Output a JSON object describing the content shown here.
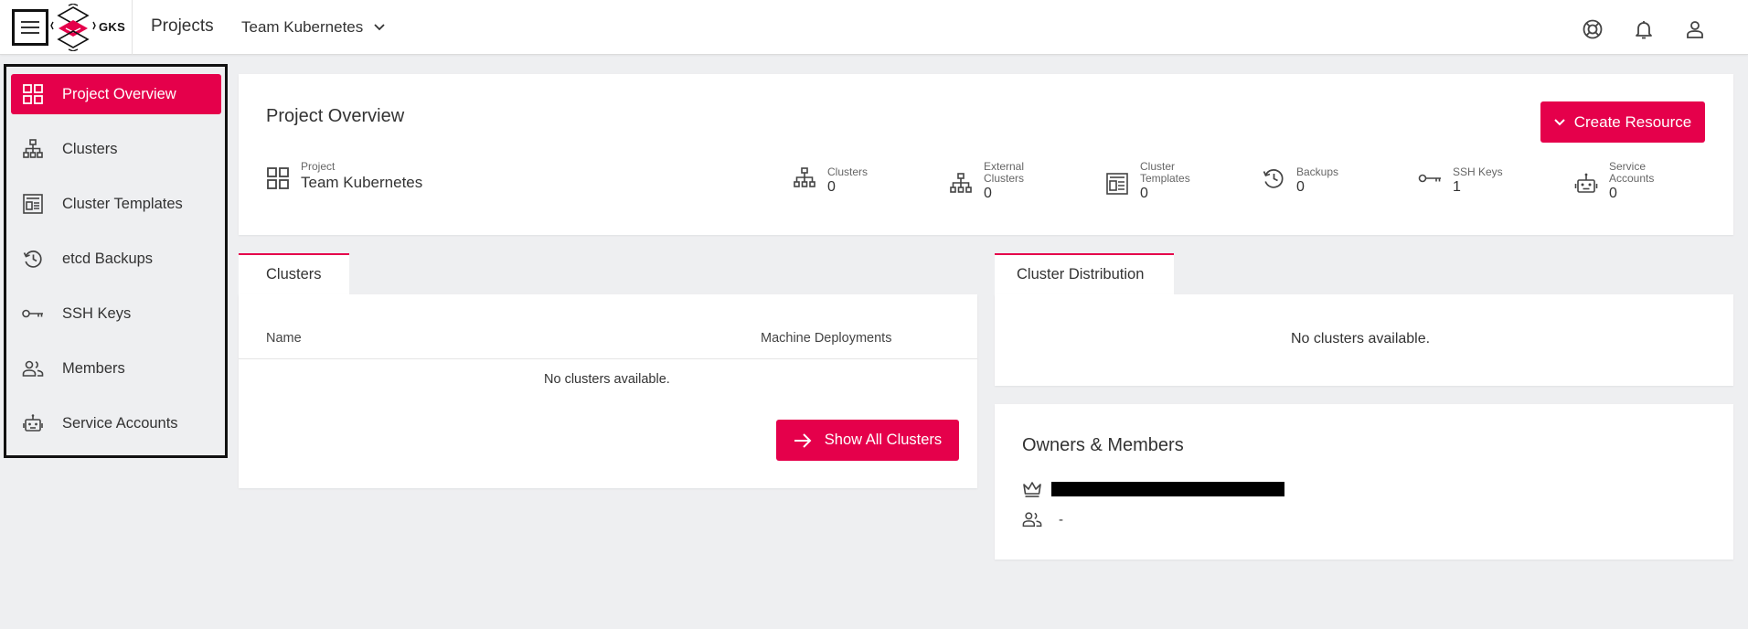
{
  "app": {
    "brand": "GKS",
    "projects_link": "Projects",
    "project_selector": "Team Kubernetes"
  },
  "sidebar": {
    "items": [
      {
        "label": "Project Overview",
        "icon": "dashboard-grid-icon",
        "active": true
      },
      {
        "label": "Clusters",
        "icon": "cluster-hierarchy-icon"
      },
      {
        "label": "Cluster Templates",
        "icon": "template-icon"
      },
      {
        "label": "etcd Backups",
        "icon": "history-icon"
      },
      {
        "label": "SSH Keys",
        "icon": "key-icon"
      },
      {
        "label": "Members",
        "icon": "members-icon"
      },
      {
        "label": "Service Accounts",
        "icon": "robot-icon"
      }
    ]
  },
  "overview": {
    "title": "Project Overview",
    "create_button": "Create Resource",
    "project_label": "Project",
    "project_name": "Team Kubernetes",
    "stats": [
      {
        "label1": "Clusters",
        "label2": "",
        "value": "0",
        "icon": "cluster-hierarchy-icon"
      },
      {
        "label1": "External",
        "label2": "Clusters",
        "value": "0",
        "icon": "cluster-hierarchy-icon"
      },
      {
        "label1": "Cluster",
        "label2": "Templates",
        "value": "0",
        "icon": "template-icon"
      },
      {
        "label1": "Backups",
        "label2": "",
        "value": "0",
        "icon": "history-icon"
      },
      {
        "label1": "SSH Keys",
        "label2": "",
        "value": "1",
        "icon": "key-icon"
      },
      {
        "label1": "Service",
        "label2": "Accounts",
        "value": "0",
        "icon": "robot-icon"
      }
    ]
  },
  "clusters_panel": {
    "tab": "Clusters",
    "col_name": "Name",
    "col_machine": "Machine Deployments",
    "empty": "No clusters available.",
    "show_all_button": "Show All Clusters"
  },
  "distribution_panel": {
    "tab": "Cluster Distribution",
    "empty": "No clusters available."
  },
  "members_panel": {
    "title": "Owners & Members",
    "members_value": "-"
  },
  "colors": {
    "accent": "#e5004b",
    "background": "#eeeff1"
  }
}
